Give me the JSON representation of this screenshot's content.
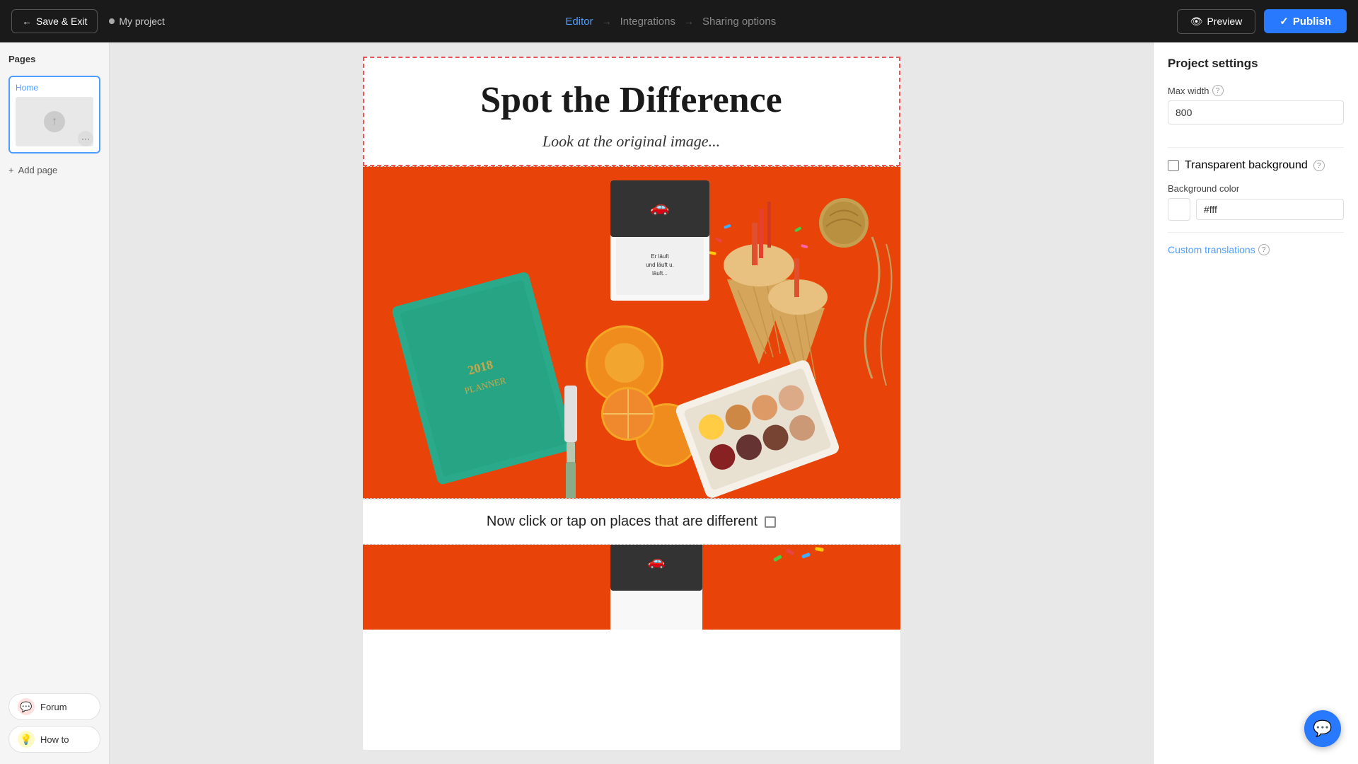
{
  "nav": {
    "save_exit_label": "Save & Exit",
    "project_name": "My project",
    "steps": [
      {
        "id": "editor",
        "label": "Editor",
        "active": true
      },
      {
        "id": "integrations",
        "label": "Integrations",
        "active": false
      },
      {
        "id": "sharing",
        "label": "Sharing options",
        "active": false
      }
    ],
    "preview_label": "Preview",
    "publish_label": "Publish"
  },
  "pages": {
    "title": "Pages",
    "items": [
      {
        "label": "Home"
      }
    ],
    "add_page_label": "Add page"
  },
  "tools": [
    {
      "id": "forum",
      "label": "Forum",
      "icon_type": "forum"
    },
    {
      "id": "howto",
      "label": "How to",
      "icon_type": "howto"
    }
  ],
  "canvas": {
    "spot_title": "Spot the Difference",
    "spot_subtitle": "Look at the original image...",
    "click_instruction": "Now click or tap on places that are different"
  },
  "settings": {
    "title": "Project settings",
    "max_width_label": "Max width",
    "max_width_value": "800",
    "transparent_bg_label": "Transparent background",
    "bg_color_label": "Background color",
    "bg_color_value": "#fff",
    "custom_translations_label": "Custom translations"
  }
}
